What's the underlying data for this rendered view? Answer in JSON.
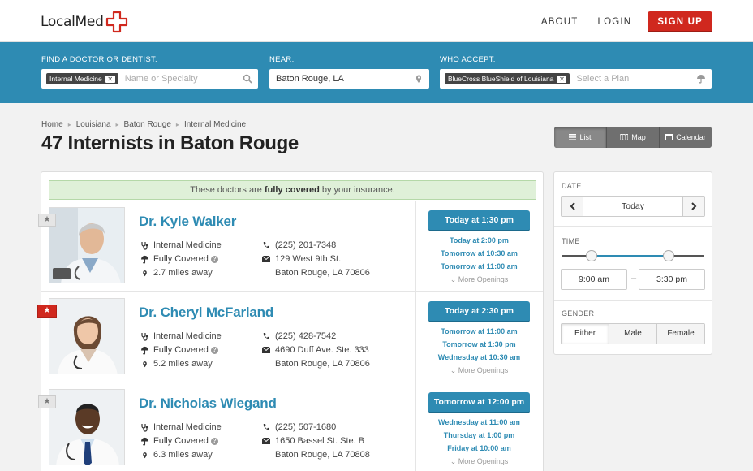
{
  "header": {
    "logo_text": "LocalMed",
    "nav": {
      "about": "ABOUT",
      "login": "LOGIN",
      "signup": "SIGN UP"
    }
  },
  "search": {
    "find": {
      "label": "FIND A DOCTOR OR DENTIST:",
      "tag": "Internal Medicine",
      "placeholder": "Name or Specialty"
    },
    "near": {
      "label": "NEAR:",
      "value": "Baton Rouge, LA"
    },
    "accept": {
      "label": "WHO ACCEPT:",
      "tag": "BlueCross BlueShield of Louisiana",
      "placeholder": "Select a Plan"
    }
  },
  "breadcrumb": [
    "Home",
    "Louisiana",
    "Baton Rouge",
    "Internal Medicine"
  ],
  "page_title": "47 Internists in Baton Rouge",
  "view_toggle": {
    "list": "List",
    "map": "Map",
    "calendar": "Calendar",
    "active": "list"
  },
  "banner": {
    "prefix": "These doctors are ",
    "bold": "fully covered",
    "suffix": " by your insurance."
  },
  "doctors": [
    {
      "name": "Dr. Kyle Walker",
      "specialty": "Internal Medicine",
      "coverage": "Fully Covered",
      "distance": "2.7 miles away",
      "phone": "(225) 201-7348",
      "address1": "129 West 9th St.",
      "address2": "Baton Rouge, LA 70806",
      "favorite": false,
      "first_slot": {
        "day": "Today",
        "time": "at 1:30 pm"
      },
      "slots": [
        "Today at 2:00 pm",
        "Tomorrow at 10:30 am",
        "Tomorrow at 11:00 am"
      ],
      "more": "More Openings"
    },
    {
      "name": "Dr. Cheryl McFarland",
      "specialty": "Internal Medicine",
      "coverage": "Fully Covered",
      "distance": "5.2 miles away",
      "phone": "(225) 428-7542",
      "address1": "4690 Duff Ave. Ste. 333",
      "address2": "Baton Rouge, LA 70806",
      "favorite": true,
      "first_slot": {
        "day": "Today",
        "time": "at 2:30 pm"
      },
      "slots": [
        "Tomorrow at 11:00 am",
        "Tomorrow at 1:30 pm",
        "Wednesday at 10:30 am"
      ],
      "more": "More Openings"
    },
    {
      "name": "Dr. Nicholas Wiegand",
      "specialty": "Internal Medicine",
      "coverage": "Fully Covered",
      "distance": "6.3 miles away",
      "phone": "(225) 507-1680",
      "address1": "1650 Bassel St. Ste. B",
      "address2": "Baton Rouge, LA 70808",
      "favorite": false,
      "first_slot": {
        "day": "Tomorrow",
        "time": "at 12:00 pm"
      },
      "slots": [
        "Wednesday at 11:00 am",
        "Thursday at 1:00 pm",
        "Friday at 10:00 am"
      ],
      "more": "More Openings"
    }
  ],
  "filters": {
    "date_label": "DATE",
    "date_value": "Today",
    "time_label": "TIME",
    "time_from": "9:00 am",
    "time_to": "3:30 pm",
    "time_dash": "–",
    "time_range_fraction": [
      0.21,
      0.75
    ],
    "gender_label": "GENDER",
    "gender_options": [
      "Either",
      "Male",
      "Female"
    ],
    "gender_selected": "Either"
  },
  "colors": {
    "brand_blue": "#2e8bb3",
    "signup_red": "#d0281e",
    "covered_green_bg": "#dff0d8"
  }
}
